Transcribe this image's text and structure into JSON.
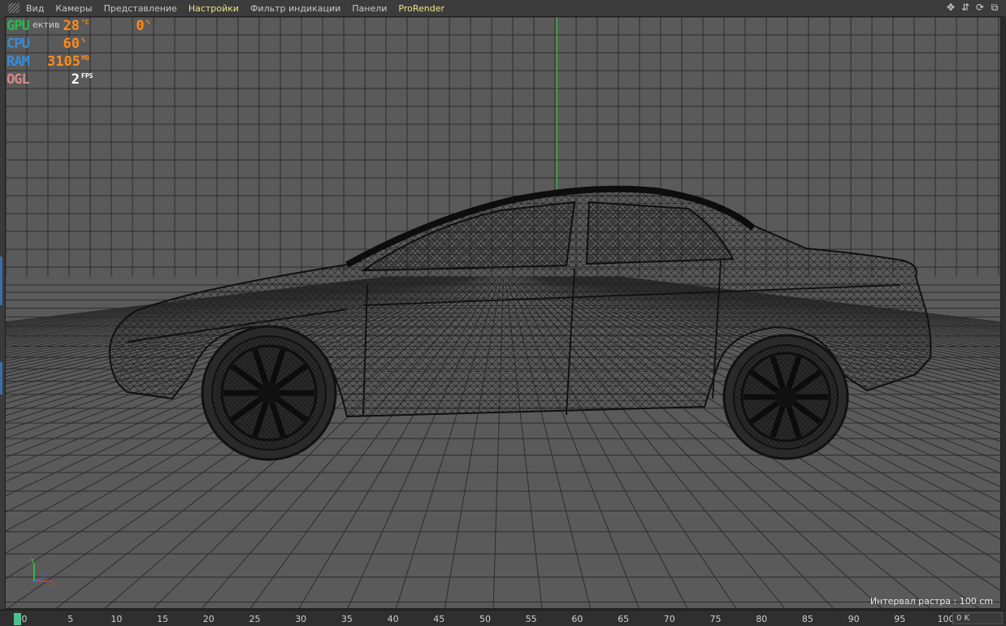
{
  "menu": {
    "items": [
      {
        "label": "Вид",
        "highlight": false
      },
      {
        "label": "Камеры",
        "highlight": false
      },
      {
        "label": "Представление",
        "highlight": false
      },
      {
        "label": "Настройки",
        "highlight": true
      },
      {
        "label": "Фильтр индикации",
        "highlight": false
      },
      {
        "label": "Панели",
        "highlight": false
      },
      {
        "label": "ProRender",
        "highlight": true
      }
    ],
    "nav_icons": [
      "move-view-icon",
      "dolly-icon",
      "rotate-view-icon",
      "maximize-view-icon"
    ]
  },
  "viewport": {
    "tag": "ектив",
    "raster_interval": "Интервал растра : 100 cm"
  },
  "hud": {
    "gpu": {
      "label": "GPU",
      "value": "28",
      "unit": "°C",
      "extra": "0",
      "extra_unit": "%",
      "color": "#2db84a"
    },
    "cpu": {
      "label": "CPU",
      "value": "60",
      "unit": "%",
      "color": "#3a8ad6"
    },
    "ram": {
      "label": "RAM",
      "value": "3105",
      "unit": "MB",
      "color": "#3a8ad6"
    },
    "ogl": {
      "label": "OGL",
      "value": "2",
      "unit": "FPS",
      "color": "#d08a8a"
    },
    "value_color": "#ff8c1a"
  },
  "axis": {
    "y": "y",
    "z": "z",
    "x": "x"
  },
  "timeline": {
    "ticks": [
      "0",
      "5",
      "10",
      "15",
      "20",
      "25",
      "30",
      "35",
      "40",
      "45",
      "50",
      "55",
      "60",
      "65",
      "70",
      "75",
      "80",
      "85",
      "90",
      "95",
      "100"
    ],
    "current_frame": 0,
    "frame_field": "0 K"
  }
}
